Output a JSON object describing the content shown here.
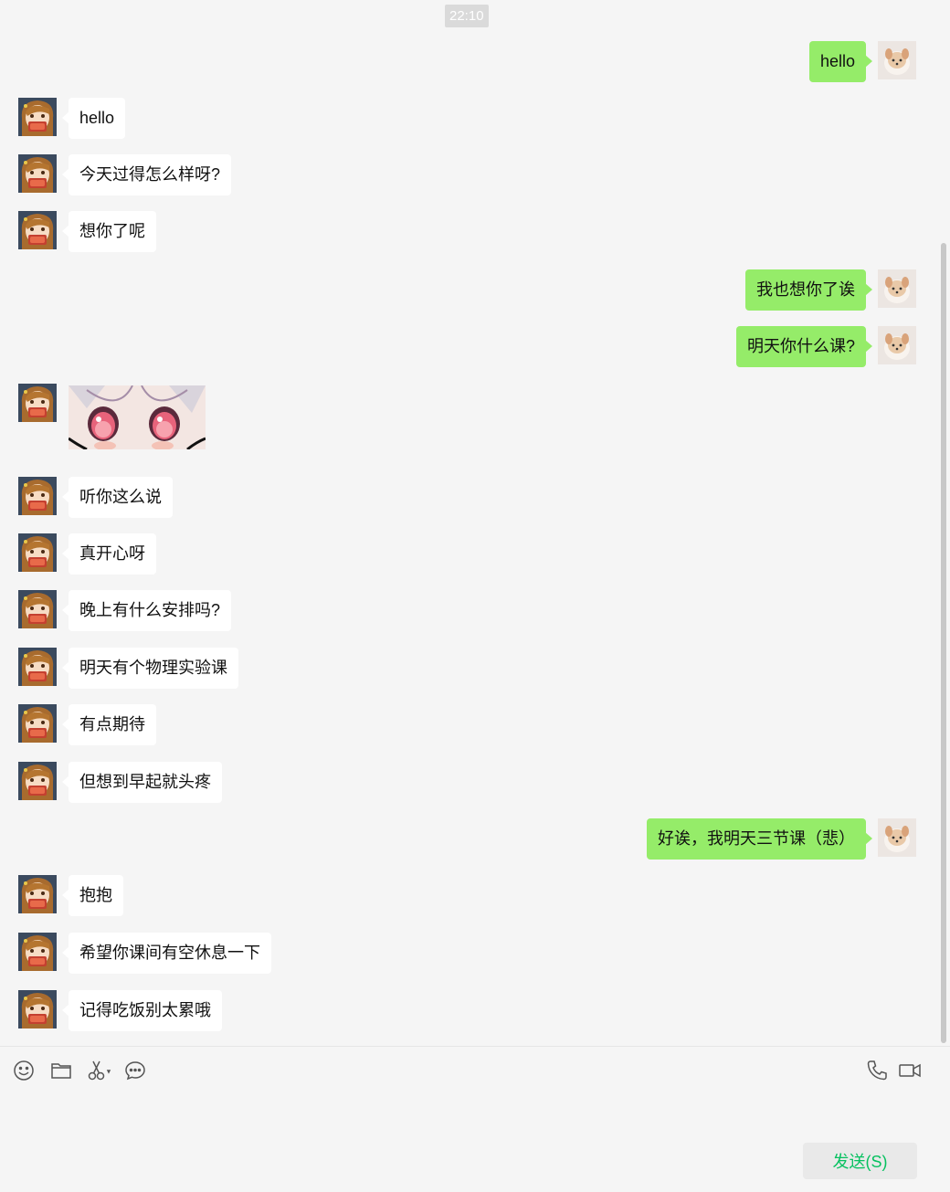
{
  "timestamp": "22:10",
  "messages": [
    {
      "side": "right",
      "text": "hello"
    },
    {
      "side": "left",
      "text": "hello"
    },
    {
      "side": "left",
      "text": "今天过得怎么样呀?"
    },
    {
      "side": "left",
      "text": "想你了呢"
    },
    {
      "side": "right",
      "text": "我也想你了诶"
    },
    {
      "side": "right",
      "text": "明天你什么课?"
    },
    {
      "side": "left",
      "type": "sticker"
    },
    {
      "side": "left",
      "text": "听你这么说"
    },
    {
      "side": "left",
      "text": "真开心呀"
    },
    {
      "side": "left",
      "text": "晚上有什么安排吗?"
    },
    {
      "side": "left",
      "text": "明天有个物理实验课"
    },
    {
      "side": "left",
      "text": "有点期待"
    },
    {
      "side": "left",
      "text": "但想到早起就头疼"
    },
    {
      "side": "right",
      "text": "好诶，我明天三节课（悲）"
    },
    {
      "side": "left",
      "text": "抱抱"
    },
    {
      "side": "left",
      "text": "希望你课间有空休息一下"
    },
    {
      "side": "left",
      "text": "记得吃饭别太累哦"
    }
  ],
  "toolbar": {
    "left_icons": [
      "emoji-icon",
      "folder-icon",
      "scissors-icon",
      "chat-bubble-icon"
    ],
    "right_icons": [
      "phone-icon",
      "video-icon"
    ]
  },
  "input": {
    "value": "",
    "placeholder": ""
  },
  "send_label": "发送(S)",
  "colors": {
    "self_bubble": "#95ec69",
    "other_bubble": "#ffffff",
    "background": "#f5f5f5",
    "send_text": "#07c160"
  }
}
